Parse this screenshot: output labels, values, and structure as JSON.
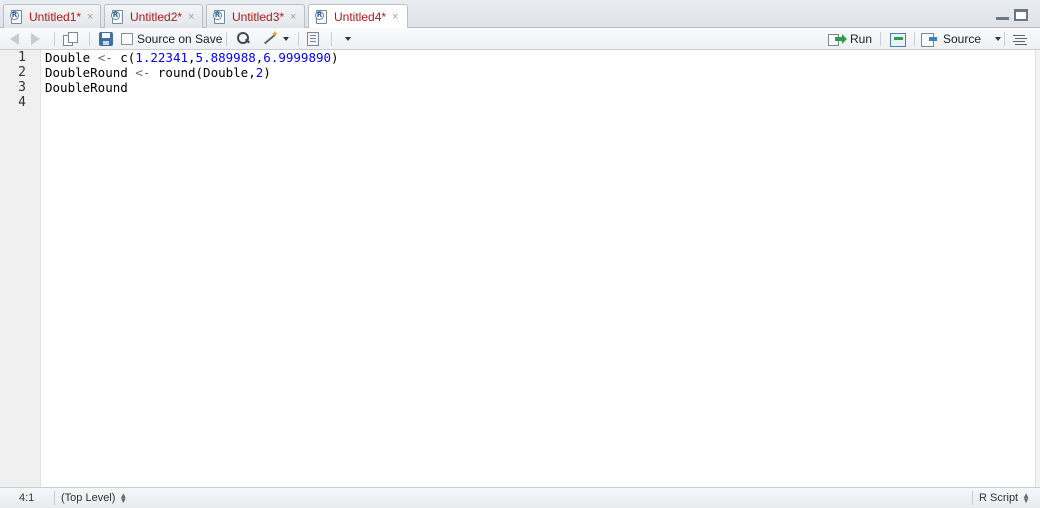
{
  "tabs": [
    {
      "label": "Untitled1*",
      "close": "×"
    },
    {
      "label": "Untitled2*",
      "close": "×"
    },
    {
      "label": "Untitled3*",
      "close": "×"
    },
    {
      "label": "Untitled4*",
      "close": "×"
    }
  ],
  "active_tab": 3,
  "toolbar": {
    "source_on_save_label": "Source on Save",
    "source_on_save_checked": false,
    "run_label": "Run",
    "source_label": "Source"
  },
  "editor": {
    "line_numbers": [
      "1",
      "2",
      "3",
      "4"
    ],
    "lines": [
      [
        {
          "t": "Double ",
          "c": "plain"
        },
        {
          "t": "<-",
          "c": "op"
        },
        {
          "t": " c(",
          "c": "plain"
        },
        {
          "t": "1.22341",
          "c": "num"
        },
        {
          "t": ",",
          "c": "plain"
        },
        {
          "t": "5.889988",
          "c": "num"
        },
        {
          "t": ",",
          "c": "plain"
        },
        {
          "t": "6.9999890",
          "c": "num"
        },
        {
          "t": ")",
          "c": "plain"
        }
      ],
      [
        {
          "t": "DoubleRound ",
          "c": "plain"
        },
        {
          "t": "<-",
          "c": "op"
        },
        {
          "t": " round(Double,",
          "c": "plain"
        },
        {
          "t": "2",
          "c": "num"
        },
        {
          "t": ")",
          "c": "plain"
        }
      ],
      [
        {
          "t": "DoubleRound",
          "c": "plain"
        }
      ],
      []
    ]
  },
  "status": {
    "cursor": "4:1",
    "scope": "(Top Level)",
    "file_type": "R Script"
  },
  "colors": {
    "tab_label": "#b01818",
    "number": "#0000ff",
    "operator": "#6a6a6a",
    "run_arrow": "#2e9e4a",
    "source_arrow": "#3d7fc8"
  }
}
